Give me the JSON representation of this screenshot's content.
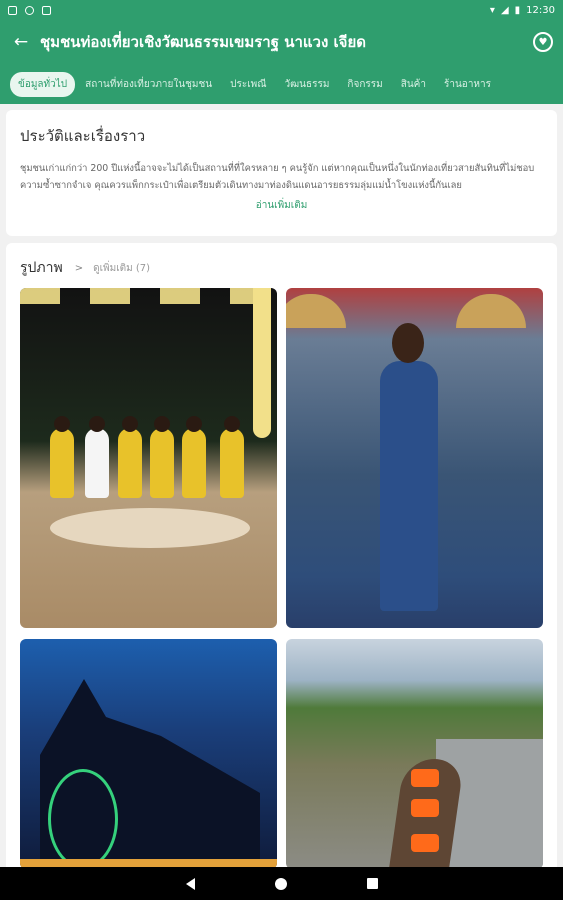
{
  "status": {
    "time": "12:30"
  },
  "appbar": {
    "title": "ชุมชนท่องเที่ยวเชิงวัฒนธรรมเขมราฐ นาแวง เจียด"
  },
  "tabs": [
    {
      "label": "ข้อมูลทั่วไป",
      "active": true
    },
    {
      "label": "สถานที่ท่องเที่ยวภายในชุมชน",
      "active": false
    },
    {
      "label": "ประเพณี",
      "active": false
    },
    {
      "label": "วัฒนธรรม",
      "active": false
    },
    {
      "label": "กิจกรรม",
      "active": false
    },
    {
      "label": "สินค้า",
      "active": false
    },
    {
      "label": "ร้านอาหาร",
      "active": false
    }
  ],
  "history": {
    "title": "ประวัติและเรื่องราว",
    "body": "ชุมชนเก่าแก่กว่า 200 ปีแห่งนี้อาจจะไม่ได้เป็นสถานที่ที่ใครหลาย ๆ คนรู้จัก แต่หากคุณเป็นหนึ่งในนักท่องเที่ยวสายสันทินที่ไม่ชอบความซ้ำซากจำเจ คุณควรแพ็กกระเป๋าเพื่อเตรียมตัวเดินทางมาท่องดินแดนอารยธรรมลุ่มแม่น้ำโขงแห่งนี้กันเลย",
    "read_more": "อ่านเพิ่มเติม"
  },
  "photos": {
    "title": "รูปภาพ",
    "see_all": "ดูเพิ่มเติม (7)"
  },
  "colors": {
    "brand": "#2f9e6e"
  },
  "icons": {
    "back": "arrow-left",
    "favorite": "heart-circle"
  }
}
